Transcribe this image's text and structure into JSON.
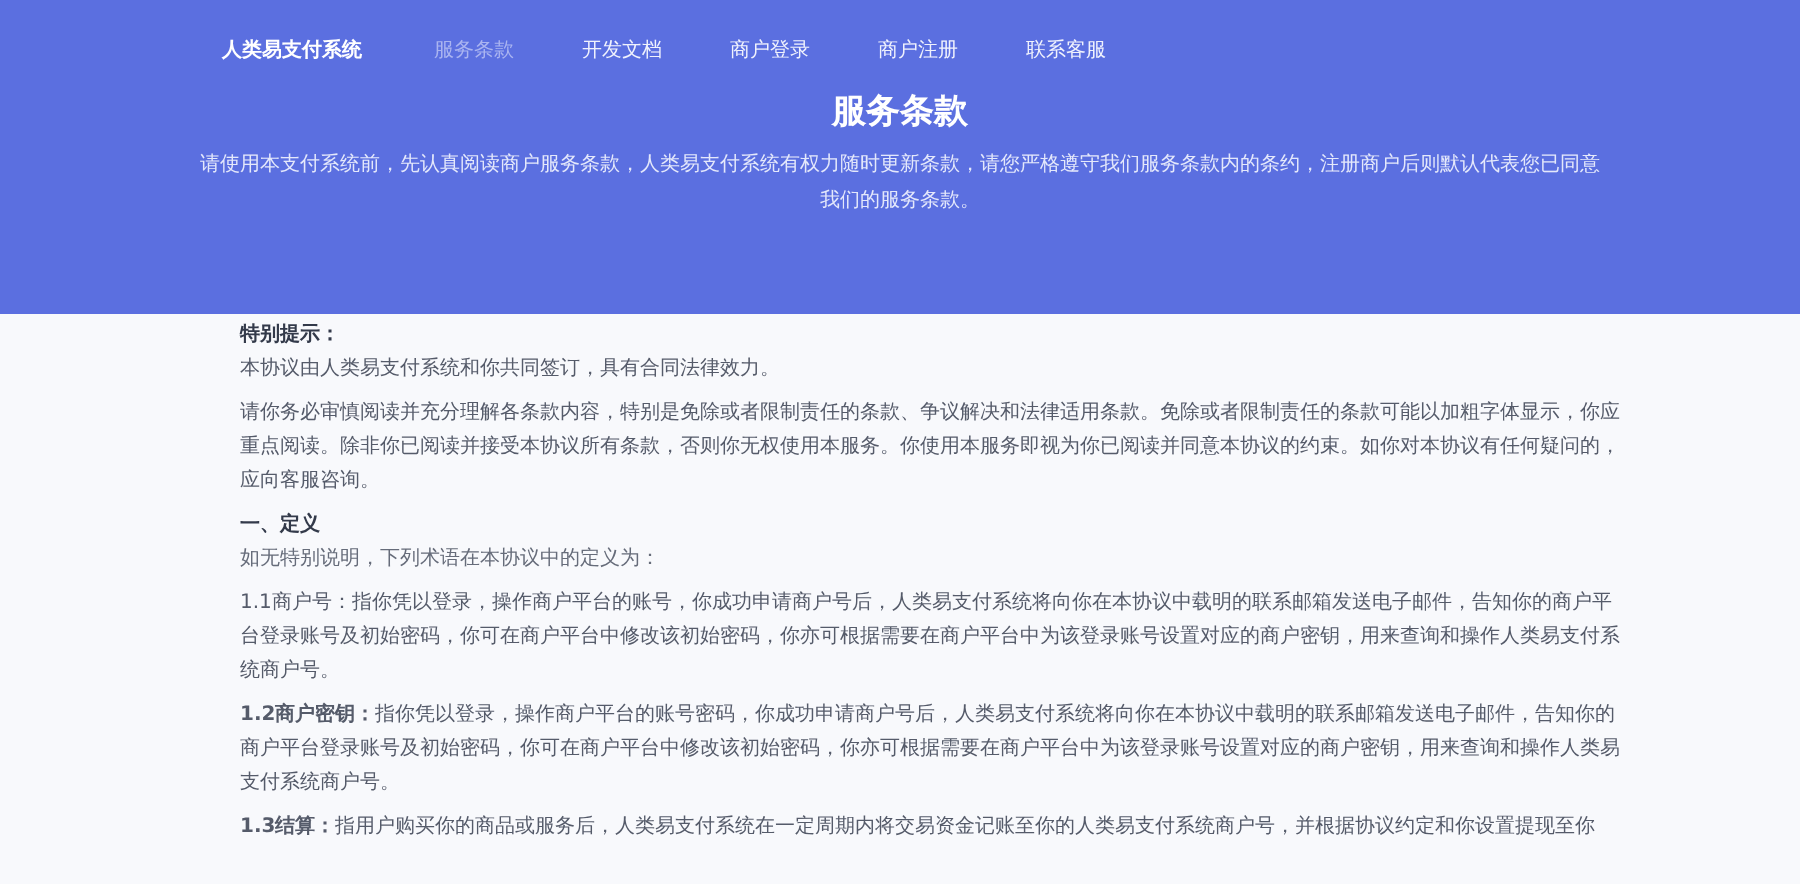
{
  "nav": {
    "brand": "人类易支付系统",
    "items": [
      {
        "label": "服务条款",
        "selected": true
      },
      {
        "label": "开发文档",
        "selected": false
      },
      {
        "label": "商户登录",
        "selected": false
      },
      {
        "label": "商户注册",
        "selected": false
      },
      {
        "label": "联系客服",
        "selected": false
      }
    ]
  },
  "hero": {
    "title": "服务条款",
    "subtitle": "请使用本支付系统前，先认真阅读商户服务条款，人类易支付系统有权力随时更新条款，请您严格遵守我们服务条款内的条约，注册商户后则默认代表您已同意我们的服务条款。"
  },
  "content": [
    {
      "kind": "heading",
      "text": "特别提示："
    },
    {
      "kind": "paragraph",
      "text": "本协议由人类易支付系统和你共同签订，具有合同法律效力。"
    },
    {
      "kind": "paragraph",
      "text": "请你务必审慎阅读并充分理解各条款内容，特别是免除或者限制责任的条款、争议解决和法律适用条款。免除或者限制责任的条款可能以加粗字体显示，你应重点阅读。除非你已阅读并接受本协议所有条款，否则你无权使用本服务。你使用本服务即视为你已阅读并同意本协议的约束。如你对本协议有任何疑问的，应向客服咨询。"
    },
    {
      "kind": "heading",
      "text": "一、定义"
    },
    {
      "kind": "lead",
      "text": "如无特别说明，下列术语在本协议中的定义为："
    },
    {
      "kind": "paragraph",
      "text": "1.1商户号：指你凭以登录，操作商户平台的账号，你成功申请商户号后，人类易支付系统将向你在本协议中载明的联系邮箱发送电子邮件，告知你的商户平台登录账号及初始密码，你可在商户平台中修改该初始密码，你亦可根据需要在商户平台中为该登录账号设置对应的商户密钥，用来查询和操作人类易支付系统商户号。"
    },
    {
      "kind": "paragraph",
      "text": "**1.2商户密钥：**指你凭以登录，操作商户平台的账号密码，你成功申请商户号后，人类易支付系统将向你在本协议中载明的联系邮箱发送电子邮件，告知你的商户平台登录账号及初始密码，你可在商户平台中修改该初始密码，你亦可根据需要在商户平台中为该登录账号设置对应的商户密钥，用来查询和操作人类易支付系统商户号。"
    },
    {
      "kind": "paragraph",
      "text": "**1.3结算：**指用户购买你的商品或服务后，人类易支付系统在一定周期内将交易资金记账至你的人类易支付系统商户号，并根据协议约定和你设置提现至你"
    }
  ]
}
